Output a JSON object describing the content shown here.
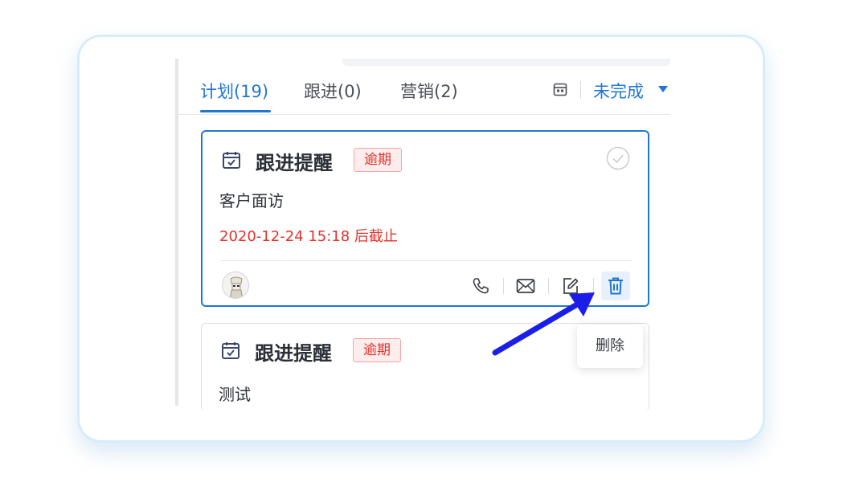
{
  "tabs": [
    {
      "label": "计划(19)",
      "active": true
    },
    {
      "label": "跟进(0)",
      "active": false
    },
    {
      "label": "营销(2)",
      "active": false
    }
  ],
  "filter": {
    "label": "未完成",
    "icon": "calendar-icon"
  },
  "cards": [
    {
      "title": "跟进提醒",
      "badge": "逾期",
      "subject": "客户面访",
      "deadline": "2020-12-24 15:18 后截止",
      "actions": [
        "phone-icon",
        "mail-icon",
        "edit-icon",
        "delete-icon"
      ]
    },
    {
      "title": "跟进提醒",
      "badge": "逾期",
      "subject": "测试"
    }
  ],
  "tooltip": {
    "text": "删除"
  },
  "colors": {
    "accent": "#1f76d3",
    "danger": "#e2322d",
    "badge_bg": "#ffeded",
    "arrow": "#1a1ee6"
  }
}
